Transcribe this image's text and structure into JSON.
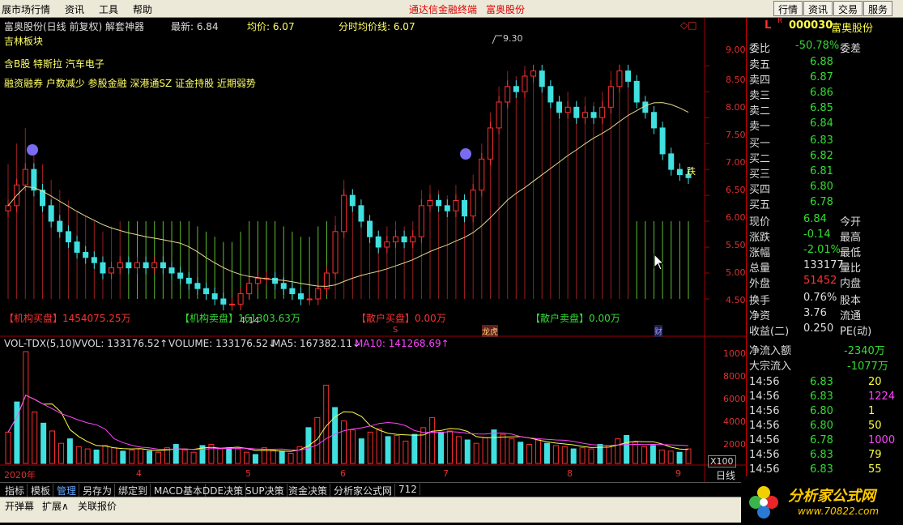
{
  "menu": {
    "items": [
      "展市场行情",
      "资讯",
      "工具",
      "帮助"
    ],
    "center_title": "通达信金融终端",
    "center_stock": "富奥股份",
    "right_buttons": [
      "行情",
      "资讯",
      "交易",
      "服务"
    ]
  },
  "chart_header": {
    "title": "富奥股份(日线 前复权) 解套神器",
    "latest": "最新: 6.84",
    "avg": "均价: 6.07",
    "timeline": "分时均价线: 6.07",
    "block": "吉林板块",
    "concepts": "含B股 特斯拉 汽车电子",
    "tags": "融资融券 户数减少 参股金融 深港通SZ 证金持股 近期弱势",
    "icons": "◇□"
  },
  "main_labels": {
    "high_label": "9.30",
    "low_label": "4.14",
    "inst_buy": "【机构买盘】1454075.25万",
    "inst_sell": "【机构卖盘】161303.63万",
    "retail_buy": "【散户买盘】0.00万",
    "retail_sell": "【散户卖盘】0.00万",
    "marker_s": "S",
    "marker_rank": "龙虎",
    "marker_cai": "财",
    "tag_die": "跌"
  },
  "price_axis": [
    "9.00",
    "8.50",
    "8.00",
    "7.50",
    "7.00",
    "6.50",
    "6.00",
    "5.50",
    "5.00",
    "4.50"
  ],
  "vol_header": {
    "name": "VOL-TDX(5,10)",
    "vvol": "VVOL: 133176.52↑",
    "volume": "VOLUME: 133176.52↓",
    "ma5": "MA5: 167382.11↓",
    "ma10": "MA10: 141268.69↑"
  },
  "vol_axis": [
    "10000",
    "8000",
    "6000",
    "4000",
    "2000"
  ],
  "vol_unit": "X100",
  "date_axis": [
    "2020年",
    "4",
    "5",
    "6",
    "7",
    "8",
    "9"
  ],
  "period": "日线",
  "chart_data": {
    "type": "candlestick",
    "ylim": [
      4.14,
      9.3
    ],
    "vol_ylim": [
      0,
      10000
    ],
    "closes": [
      6.3,
      6.7,
      7.0,
      6.6,
      6.3,
      6.0,
      5.8,
      5.6,
      5.4,
      5.3,
      5.2,
      5.0,
      5.1,
      5.2,
      5.1,
      5.2,
      5.1,
      5.2,
      5.1,
      5.0,
      4.9,
      4.8,
      4.7,
      4.6,
      4.5,
      4.4,
      4.4,
      4.6,
      4.8,
      4.9,
      4.9,
      4.8,
      4.7,
      4.6,
      4.5,
      4.5,
      4.7,
      5.0,
      5.8,
      6.5,
      6.3,
      6.0,
      5.7,
      5.5,
      5.6,
      5.7,
      5.6,
      5.7,
      6.3,
      6.4,
      6.3,
      6.2,
      6.4,
      6.1,
      6.6,
      7.2,
      7.8,
      8.3,
      8.6,
      8.5,
      8.8,
      8.9,
      8.6,
      8.3,
      8.1,
      8.2,
      8.0,
      8.1,
      8.0,
      8.2,
      8.6,
      8.9,
      8.7,
      8.3,
      8.1,
      7.8,
      7.3,
      7.0,
      6.9,
      6.84
    ],
    "volumes": [
      2800,
      5500,
      10000,
      4600,
      3600,
      2900,
      1800,
      2200,
      1500,
      1300,
      1200,
      1600,
      1400,
      1100,
      1200,
      1300,
      1100,
      1000,
      1400,
      1700,
      1200,
      1000,
      1600,
      1700,
      1300,
      1400,
      1300,
      1000,
      800,
      1400,
      1200,
      1100,
      900,
      1500,
      3200,
      4100,
      7000,
      5000,
      3800,
      3000,
      2200,
      2800,
      3100,
      2400,
      2500,
      2000,
      2600,
      3200,
      4100,
      2800,
      2900,
      2400,
      2100,
      1800,
      2300,
      3000,
      2600,
      2200,
      1900,
      1700,
      2100,
      1800,
      1600,
      1500,
      1300,
      1400,
      1300,
      1700,
      1600,
      2200,
      2500,
      1900,
      1500,
      1600,
      1200,
      1100,
      1000,
      1300
    ]
  },
  "quote": {
    "code": "000030",
    "name": "富奥股份",
    "l": "L",
    "r": "R",
    "weibi_label": "委比",
    "weibi": "-50.78%",
    "weicha": "委差",
    "asks": [
      {
        "label": "卖五",
        "price": "6.88"
      },
      {
        "label": "卖四",
        "price": "6.87"
      },
      {
        "label": "卖三",
        "price": "6.86"
      },
      {
        "label": "卖二",
        "price": "6.85"
      },
      {
        "label": "卖一",
        "price": "6.84"
      }
    ],
    "bids": [
      {
        "label": "买一",
        "price": "6.83"
      },
      {
        "label": "买二",
        "price": "6.82"
      },
      {
        "label": "买三",
        "price": "6.81"
      },
      {
        "label": "买四",
        "price": "6.80"
      },
      {
        "label": "买五",
        "price": "6.78"
      }
    ],
    "stats": [
      {
        "l": "现价",
        "v": "6.84",
        "r": "今开"
      },
      {
        "l": "涨跌",
        "v": "-0.14",
        "r": "最高"
      },
      {
        "l": "涨幅",
        "v": "-2.01%",
        "r": "最低"
      },
      {
        "l": "总量",
        "v": "133177",
        "r": "量比"
      },
      {
        "l": "外盘",
        "v": "51452",
        "r": "内盘"
      },
      {
        "l": "换手",
        "v": "0.76%",
        "r": "股本"
      },
      {
        "l": "净资",
        "v": "3.76",
        "r": "流通"
      },
      {
        "l": "收益(二)",
        "v": "0.250",
        "r": "PE(动)"
      }
    ],
    "netflow_label": "净流入额",
    "netflow": "-2340万",
    "block_label": "大宗流入",
    "block": "-1077万",
    "ticks": [
      {
        "t": "14:56",
        "p": "6.83",
        "v": "20"
      },
      {
        "t": "14:56",
        "p": "6.83",
        "v": "1224"
      },
      {
        "t": "14:56",
        "p": "6.80",
        "v": "1"
      },
      {
        "t": "14:56",
        "p": "6.80",
        "v": "50"
      },
      {
        "t": "14:56",
        "p": "6.78",
        "v": "1000"
      },
      {
        "t": "14:56",
        "p": "6.83",
        "v": "79"
      },
      {
        "t": "14:56",
        "p": "6.83",
        "v": "55"
      }
    ]
  },
  "tabs": [
    "指标",
    "模板",
    "管理",
    "另存为",
    "绑定到",
    "MACD基本",
    "DDE决策",
    "SUP决策",
    "资金决策",
    "分析家公式网",
    "712"
  ],
  "bottom": [
    "开弹幕",
    "扩展∧",
    "关联报价"
  ],
  "logo": {
    "title": "分析家公式网",
    "url": "www.70822.com"
  }
}
